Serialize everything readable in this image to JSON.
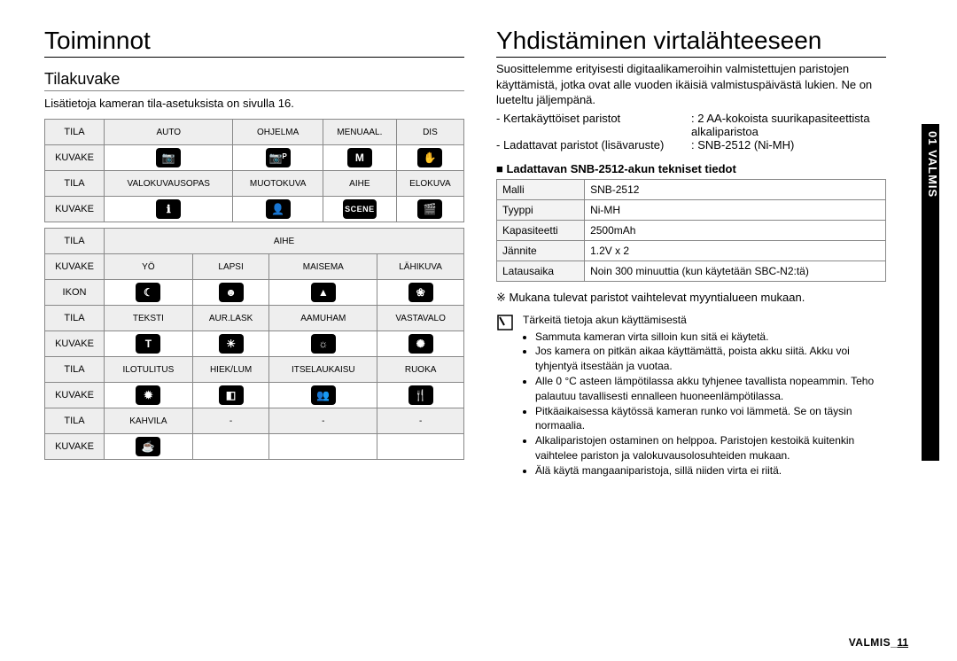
{
  "left": {
    "title": "Toiminnot",
    "subtitle": "Tilakuvake",
    "lead": "Lisätietoja kameran tila-asetuksista on sivulla 16.",
    "table1": {
      "rows": [
        {
          "label": "TILA",
          "cells": [
            "AUTO",
            "OHJELMA",
            "MENUAAL.",
            "DIS"
          ],
          "type": "hdr"
        },
        {
          "label": "KUVAKE",
          "icons": [
            "camera-icon",
            "camera-p-icon",
            "m-icon",
            "hand-icon"
          ]
        },
        {
          "label": "TILA",
          "cells": [
            "VALOKUVAUSOPAS",
            "MUOTOKUVA",
            "AIHE",
            "ELOKUVA"
          ],
          "type": "hdr"
        },
        {
          "label": "KUVAKE",
          "icons": [
            "guide-icon",
            "portrait-icon",
            "scene-icon",
            "movie-icon"
          ]
        }
      ]
    },
    "table2": {
      "aihe_header": "AIHE",
      "rows": [
        {
          "label": "KUVAKE",
          "cells": [
            "YÖ",
            "LAPSI",
            "MAISEMA",
            "LÄHIKUVA"
          ],
          "type": "hdr"
        },
        {
          "label": "IKON",
          "icons": [
            "night-icon",
            "child-icon",
            "landscape-icon",
            "closeup-icon"
          ]
        },
        {
          "label": "TILA",
          "cells": [
            "TEKSTI",
            "AUR.LASK",
            "AAMUHAM",
            "VASTAVALO"
          ],
          "type": "hdr"
        },
        {
          "label": "KUVAKE",
          "icons": [
            "text-icon",
            "sunset-icon",
            "dawn-icon",
            "backlight-icon"
          ]
        },
        {
          "label": "TILA",
          "cells": [
            "ILOTULITUS",
            "HIEK/LUM",
            "ITSELAUKAISU",
            "RUOKA"
          ],
          "type": "hdr"
        },
        {
          "label": "KUVAKE",
          "icons": [
            "firework-icon",
            "beach-icon",
            "selftimer-icon",
            "food-icon"
          ]
        },
        {
          "label": "TILA",
          "cells": [
            "KAHVILA",
            "-",
            "-",
            "-"
          ],
          "type": "hdr"
        },
        {
          "label": "KUVAKE",
          "icons": [
            "cafe-icon",
            null,
            null,
            null
          ]
        }
      ]
    }
  },
  "right": {
    "title": "Yhdistäminen virtalähteeseen",
    "paragraphs": [
      "Suosittelemme erityisesti digitaalikameroihin valmistettujen paristojen käyttämistä, jotka ovat alle vuoden ikäisiä valmistuspäivästä lukien. Ne on lueteltu jäljempänä."
    ],
    "battery_list": [
      {
        "k": "- Kertakäyttöiset paristot",
        "v": ": 2 AA-kokoista suurikapasiteettista alkaliparistoa"
      },
      {
        "k": "- Ladattavat paristot (lisävaruste)",
        "v": ": SNB-2512 (Ni-MH)"
      }
    ],
    "spec_title": "Ladattavan SNB-2512-akun tekniset tiedot",
    "spec": [
      [
        "Malli",
        "SNB-2512"
      ],
      [
        "Tyyppi",
        "Ni-MH"
      ],
      [
        "Kapasiteetti",
        "2500mAh"
      ],
      [
        "Jännite",
        "1.2V x 2"
      ],
      [
        "Latausaika",
        "Noin 300 minuuttia (kun käytetään SBC-N2:tä)"
      ]
    ],
    "note": "※ Mukana tulevat paristot vaihtelevat myyntialueen mukaan.",
    "info_intro": "Tärkeitä tietoja akun käyttämisestä",
    "info_items": [
      "Sammuta kameran virta silloin kun sitä ei käytetä.",
      "Jos kamera on pitkän aikaa käyttämättä, poista akku siitä. Akku voi tyhjentyä itsestään ja vuotaa.",
      "Alle 0 °C asteen lämpötilassa akku tyhjenee tavallista nopeammin. Teho palautuu tavallisesti ennalleen huoneenlämpötilassa.",
      "Pitkäaikaisessa käytössä kameran runko voi lämmetä. Se on täysin normaalia.",
      "Alkaliparistojen ostaminen on helppoa. Paristojen kestoikä kuitenkin vaihtelee pariston ja valokuvausolosuhteiden mukaan.",
      "Älä käytä mangaaniparistoja, sillä niiden virta ei riitä."
    ]
  },
  "sidetab": "01 VALMIS",
  "footer": {
    "label": "VALMIS_",
    "num": "11"
  },
  "icon_glyphs": {
    "camera-icon": "📷",
    "camera-p-icon": "📷ᴾ",
    "m-icon": "M",
    "hand-icon": "✋",
    "guide-icon": "ℹ",
    "portrait-icon": "👤",
    "scene-icon": "SCENE",
    "movie-icon": "🎬",
    "night-icon": "☾",
    "child-icon": "☻",
    "landscape-icon": "▲",
    "closeup-icon": "❀",
    "text-icon": "T",
    "sunset-icon": "☀",
    "dawn-icon": "☼",
    "backlight-icon": "✺",
    "firework-icon": "✹",
    "beach-icon": "◧",
    "selftimer-icon": "👥",
    "food-icon": "🍴",
    "cafe-icon": "☕"
  }
}
